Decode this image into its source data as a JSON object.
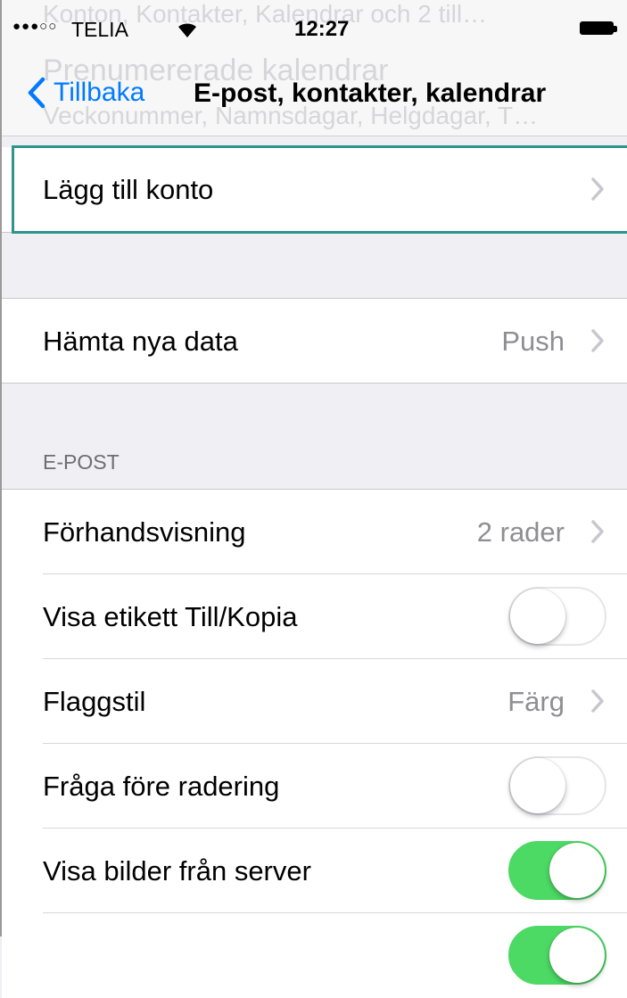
{
  "status_bar": {
    "signal": "●●●○○",
    "carrier": "TELIA",
    "time": "12:27"
  },
  "header_ghost": {
    "line1": "Konton, Kontakter, Kalendrar och 2 till…",
    "line2": "Prenumererade kalendrar",
    "line3": "Veckonummer, Namnsdagar, Helgdagar, T…"
  },
  "nav": {
    "back_label": "Tillbaka",
    "title": "E-post, kontakter, kalendrar"
  },
  "accounts": {
    "add_account": "Lägg till konto"
  },
  "fetch": {
    "label": "Hämta nya data",
    "value": "Push"
  },
  "mail_section": {
    "header": "E-POST",
    "rows": [
      {
        "label": "Förhandsvisning",
        "value": "2 rader"
      },
      {
        "label": "Visa etikett Till/Kopia",
        "toggle": false
      },
      {
        "label": "Flaggstil",
        "value": "Färg"
      },
      {
        "label": "Fråga före radering",
        "toggle": false
      },
      {
        "label": "Visa bilder från server",
        "toggle": true
      }
    ]
  },
  "colors": {
    "tint": "#007aff",
    "toggle_on": "#4cd964",
    "highlight": "#2e948c",
    "background": "#efeff4"
  }
}
